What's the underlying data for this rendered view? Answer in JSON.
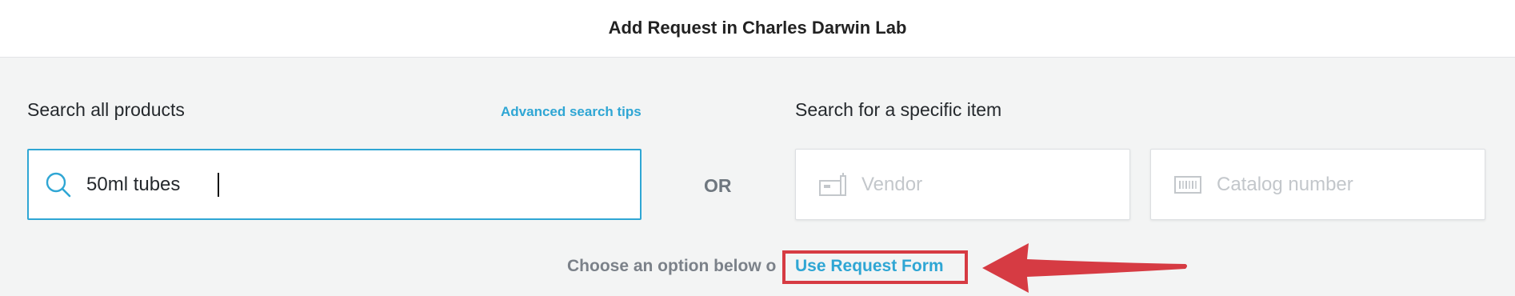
{
  "header": {
    "title": "Add Request in Charles Darwin Lab"
  },
  "search_all": {
    "label": "Search all products",
    "tips_link": "Advanced search tips",
    "value": "50ml tubes",
    "icon": "search-icon"
  },
  "or_label": "OR",
  "specific": {
    "label": "Search for a specific item",
    "vendor": {
      "placeholder": "Vendor",
      "icon": "vendor-building-icon"
    },
    "catalog": {
      "placeholder": "Catalog number",
      "icon": "barcode-icon"
    }
  },
  "footer": {
    "choose_text": "Choose an option below o",
    "request_form_link": "Use Request Form"
  },
  "colors": {
    "accent": "#2fa6d4",
    "annotation": "#d63b43",
    "background": "#f3f4f4"
  }
}
